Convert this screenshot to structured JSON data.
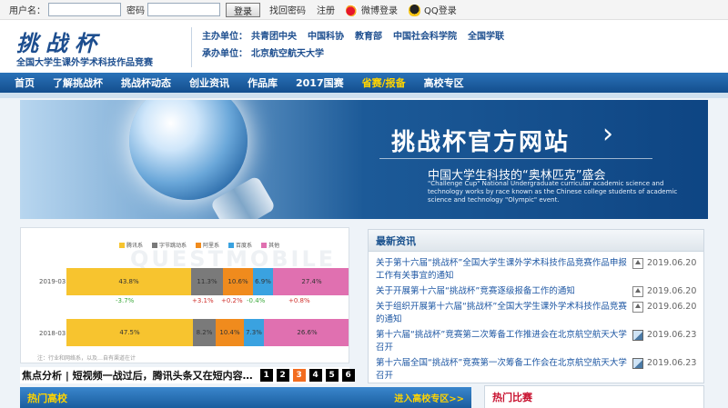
{
  "topbar": {
    "username_label": "用户名：",
    "password_label": "密码",
    "login_button": "登录",
    "forgot_link": "找回密码",
    "register_link": "注册",
    "weibo_login": "微博登录",
    "qq_login": "QQ登录"
  },
  "header": {
    "logo_title": "挑战杯",
    "logo_subtitle": "全国大学生课外学术科技作品竞赛",
    "host_label": "主办单位：",
    "hosts": [
      "共青团中央",
      "中国科协",
      "教育部",
      "中国社会科学院",
      "全国学联"
    ],
    "organizer_label": "承办单位：",
    "organizer": "北京航空航天大学"
  },
  "nav": {
    "items": [
      "首页",
      "了解挑战杯",
      "挑战杯动态",
      "创业资讯",
      "作品库",
      "2017国赛",
      "省赛/报备",
      "高校专区"
    ]
  },
  "banner": {
    "title": "挑战杯官方网站",
    "arrow": "›",
    "subtitle": "中国大学生科技的“奥林匹克”盛会",
    "english": "\"Challenge Cup\" National Undergraduate curricular academic science and technology works by race known as the Chinese college students of academic science and technology \"Olympic\" event."
  },
  "feature": {
    "legend": [
      {
        "label": "腾讯系",
        "color": "#f7c42f"
      },
      {
        "label": "字节跳动系",
        "color": "#7a7a7a"
      },
      {
        "label": "阿里系",
        "color": "#f08b1d"
      },
      {
        "label": "百度系",
        "color": "#3aa2e0"
      },
      {
        "label": "其他",
        "color": "#e070b0"
      }
    ],
    "rows": [
      {
        "label": "2019-03",
        "values": [
          "43.8%",
          "11.3%",
          "10.6%",
          "6.9%",
          "27.4%"
        ],
        "deltas": [
          "-3.7%",
          "+3.1%",
          "+0.2%",
          "-0.4%",
          "+0.8%"
        ]
      },
      {
        "label": "2018-03",
        "values": [
          "47.5%",
          "8.2%",
          "10.4%",
          "7.3%",
          "26.6%"
        ]
      }
    ],
    "watermark": "QUESTMOBILE",
    "note": "注：行业和网络系，以及…自有渠道在计"
  },
  "caption": {
    "text": "焦点分析 | 短视频一战过后，腾讯头条又在短内容…",
    "pages": [
      "1",
      "2",
      "3",
      "4",
      "5",
      "6"
    ],
    "active_page": "3"
  },
  "news": {
    "heading": "最新资讯",
    "items": [
      {
        "title": "关于第十六届“挑战杯”全国大学生课外学术科技作品竞赛作品申报工作有关事宜的通知",
        "date": "2019.06.20",
        "icon": "up-icon"
      },
      {
        "title": "关于开展第十六届“挑战杯”竞赛逐级报备工作的通知",
        "date": "2019.06.20",
        "icon": "up-icon"
      },
      {
        "title": "关于组织开展第十六届“挑战杯”全国大学生课外学术科技作品竞赛的通知",
        "date": "2019.06.20",
        "icon": "up-icon"
      },
      {
        "title": "第十六届“挑战杯”竞赛第二次筹备工作推进会在北京航空航天大学召开",
        "date": "2019.06.23",
        "icon": "image-icon"
      },
      {
        "title": "第十六届全国“挑战杯”竞赛第一次筹备工作会在北京航空航天大学召开",
        "date": "2019.06.23",
        "icon": "image-icon"
      }
    ]
  },
  "sections": {
    "hot_schools": "热门高校",
    "enter_schools": "进入高校专区>>",
    "hot_contest": "热门比赛"
  }
}
